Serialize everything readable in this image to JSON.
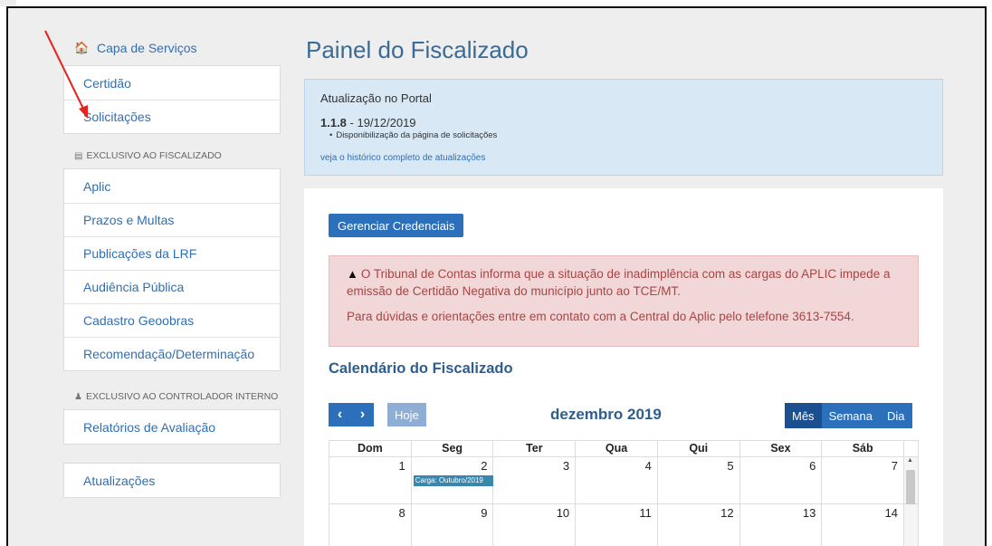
{
  "sidebar": {
    "home_label": "Capa de Serviços",
    "general_items": [
      {
        "label": "Certidão"
      },
      {
        "label": "Solicitações"
      }
    ],
    "section_fiscalizado": "EXCLUSIVO AO FISCALIZADO",
    "fiscalizado_items": [
      {
        "label": "Aplic"
      },
      {
        "label": "Prazos e Multas"
      },
      {
        "label": "Publicações da LRF"
      },
      {
        "label": "Audiência Pública"
      },
      {
        "label": "Cadastro Geoobras"
      },
      {
        "label": "Recomendação/Determinação"
      }
    ],
    "section_controlador": "EXCLUSIVO AO CONTROLADOR INTERNO",
    "controlador_items": [
      {
        "label": "Relatórios de Avaliação"
      }
    ],
    "updates_label": "Atualizações"
  },
  "main": {
    "title": "Painel do Fiscalizado",
    "update_panel": {
      "title": "Atualização no Portal",
      "version": "1.1.8",
      "date": " - 19/12/2019",
      "notes": [
        "Disponibilização da página de solicitações"
      ],
      "history_link": "veja o histórico completo de atualizações"
    },
    "manage_credentials_label": "Gerenciar Credenciais",
    "alert": {
      "line1": "O Tribunal de Contas informa que a situação de inadimplência com as cargas do APLIC impede a emissão de Certidão Negativa do município junto ao TCE/MT.",
      "line2": "Para dúvidas e orientações entre em contato com a Central do Aplic pelo telefone 3613-7554."
    },
    "calendar": {
      "title": "Calendário do Fiscalizado",
      "today_label": "Hoje",
      "month": "dezembro 2019",
      "views": [
        "Mês",
        "Semana",
        "Dia"
      ],
      "weekdays": [
        "Dom",
        "Seg",
        "Ter",
        "Qua",
        "Qui",
        "Sex",
        "Sáb"
      ],
      "week1": [
        "1",
        "2",
        "3",
        "4",
        "5",
        "6",
        "7"
      ],
      "week2": [
        "8",
        "9",
        "10",
        "11",
        "12",
        "13",
        "14"
      ],
      "event_label": "Carga: Outubro/2019"
    }
  },
  "colors": {
    "link": "#2f6fb4",
    "primary_button": "#2c6fbb",
    "alert_text": "#a94442",
    "alert_bg": "#f2d7d8",
    "info_bg": "#d9e8f5",
    "annotation_arrow": "#e8231f"
  }
}
